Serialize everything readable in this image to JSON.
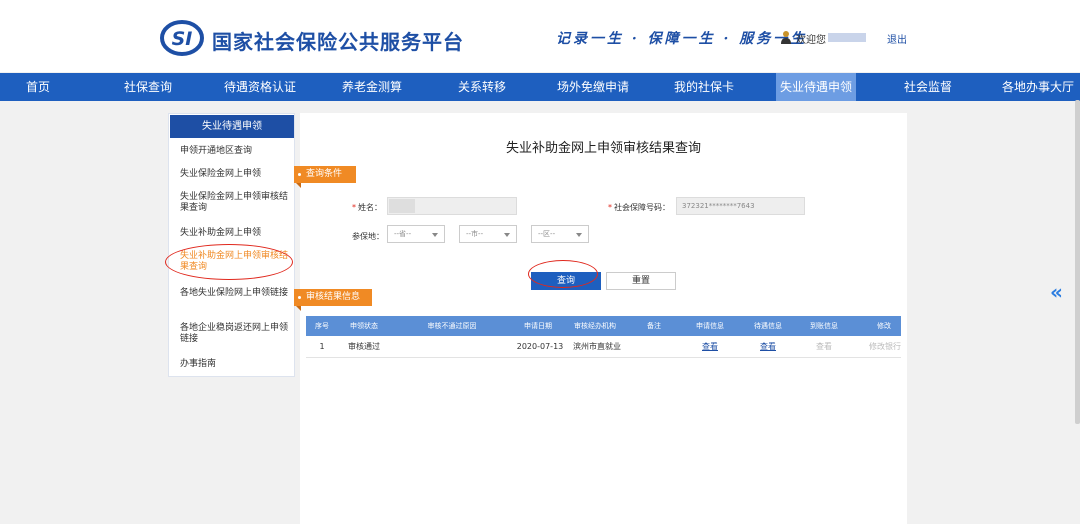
{
  "header": {
    "site_title": "国家社会保险公共服务平台",
    "slogan": "记录一生 · 保障一生 · 服务一生",
    "welcome": "欢迎您",
    "logout": "退出"
  },
  "nav": {
    "items": [
      "首页",
      "社保查询",
      "待遇资格认证",
      "养老金测算",
      "关系转移",
      "场外免缴申请",
      "我的社保卡",
      "失业待遇申领",
      "社会监督",
      "各地办事大厅"
    ],
    "active_index": 7
  },
  "sidebar": {
    "heading": "失业待遇申领",
    "items": [
      "申领开通地区查询",
      "失业保险金网上申领",
      "失业保险金网上申领审核结果查询",
      "失业补助金网上申领",
      "失业补助金网上申领审核结果查询",
      "各地失业保险网上申领链接",
      "各地企业稳岗返还网上申领链接",
      "办事指南"
    ],
    "active_index": 4
  },
  "main": {
    "title": "失业补助金网上申领审核结果查询",
    "query_tag": "查询条件",
    "name_label": "姓名：",
    "ssn_label": "社会保障号码：",
    "ssn_value": "372321********7643",
    "insured_label": "参保地：",
    "province_placeholder": "--省--",
    "city_placeholder": "--市--",
    "district_placeholder": "--区--",
    "query_button": "查询",
    "reset_button": "重置",
    "result_tag": "审核结果信息"
  },
  "table": {
    "headers": [
      "序号",
      "申领状态",
      "审核不通过原因",
      "申请日期",
      "审核经办机构",
      "备注",
      "申请信息",
      "待遇信息",
      "到账信息",
      "修改"
    ],
    "rows": [
      {
        "no": "1",
        "status": "审核通过",
        "reason": "",
        "date": "2020-07-13",
        "agency": "滨州市直就业",
        "remark": "",
        "apply_info": "查看",
        "benefit_info": "查看",
        "arrival_info": "查看",
        "modify": "修改银行"
      }
    ]
  },
  "colors": {
    "brand_blue": "#1e4fa5",
    "nav_blue": "#1e5fbf",
    "active_orange": "#f08a24",
    "annotation_red": "#e0281d"
  }
}
